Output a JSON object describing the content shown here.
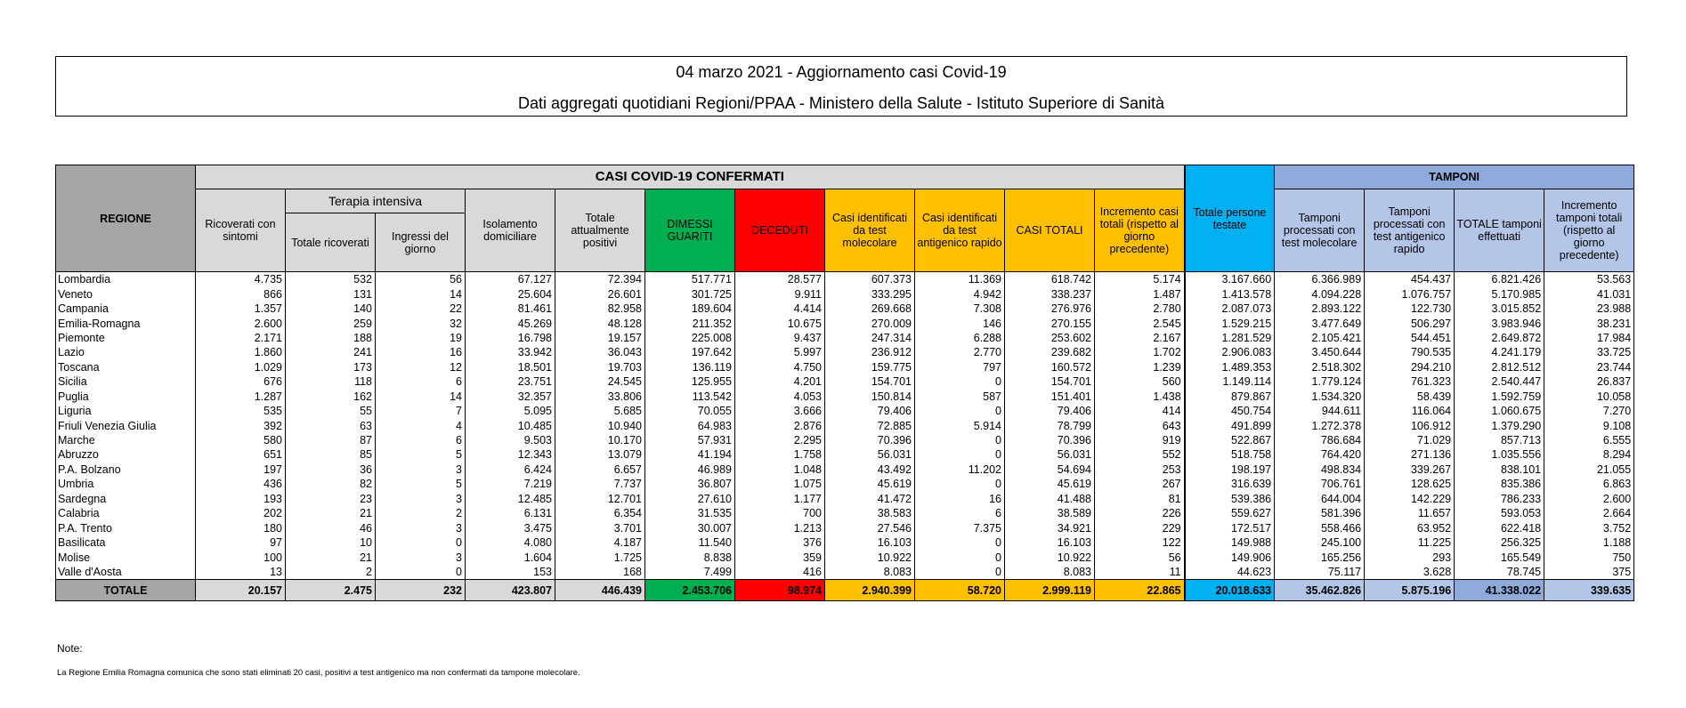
{
  "header": {
    "title": "04 marzo 2021 - Aggiornamento casi Covid-19",
    "subtitle": "Dati aggregati quotidiani Regioni/PPAA - Ministero della Salute - Istituto Superiore di Sanità"
  },
  "table": {
    "group_casi": "CASI COVID-19 CONFERMATI",
    "group_tamponi": "TAMPONI",
    "group_terapia": "Terapia intensiva",
    "columns": {
      "regione": "REGIONE",
      "ricoverati": "Ricoverati con sintomi",
      "ti_totale": "Totale ricoverati",
      "ti_ingressi": "Ingressi del giorno",
      "isolamento": "Isolamento domiciliare",
      "positivi": "Totale attualmente positivi",
      "dimessi": "DIMESSI GUARITI",
      "deceduti": "DECEDUTI",
      "casi_molecolare": "Casi identificati da test molecolare",
      "casi_antigenico": "Casi identificati da test antigenico rapido",
      "casi_totali": "CASI TOTALI",
      "incremento_casi": "Incremento casi totali (rispetto al giorno precedente)",
      "persone_testate": "Totale persone testate",
      "tamponi_molecolare": "Tamponi processati con test molecolare",
      "tamponi_antigenico": "Tamponi processati con test antigenico rapido",
      "tamponi_totale": "TOTALE tamponi effettuati",
      "incremento_tamponi": "Incremento tamponi totali (rispetto al giorno precedente)"
    },
    "rows": [
      [
        "Lombardia",
        "4.735",
        "532",
        "56",
        "67.127",
        "72.394",
        "517.771",
        "28.577",
        "607.373",
        "11.369",
        "618.742",
        "5.174",
        "3.167.660",
        "6.366.989",
        "454.437",
        "6.821.426",
        "53.563"
      ],
      [
        "Veneto",
        "866",
        "131",
        "14",
        "25.604",
        "26.601",
        "301.725",
        "9.911",
        "333.295",
        "4.942",
        "338.237",
        "1.487",
        "1.413.578",
        "4.094.228",
        "1.076.757",
        "5.170.985",
        "41.031"
      ],
      [
        "Campania",
        "1.357",
        "140",
        "22",
        "81.461",
        "82.958",
        "189.604",
        "4.414",
        "269.668",
        "7.308",
        "276.976",
        "2.780",
        "2.087.073",
        "2.893.122",
        "122.730",
        "3.015.852",
        "23.988"
      ],
      [
        "Emilia-Romagna",
        "2.600",
        "259",
        "32",
        "45.269",
        "48.128",
        "211.352",
        "10.675",
        "270.009",
        "146",
        "270.155",
        "2.545",
        "1.529.215",
        "3.477.649",
        "506.297",
        "3.983.946",
        "38.231"
      ],
      [
        "Piemonte",
        "2.171",
        "188",
        "19",
        "16.798",
        "19.157",
        "225.008",
        "9.437",
        "247.314",
        "6.288",
        "253.602",
        "2.167",
        "1.281.529",
        "2.105.421",
        "544.451",
        "2.649.872",
        "17.984"
      ],
      [
        "Lazio",
        "1.860",
        "241",
        "16",
        "33.942",
        "36.043",
        "197.642",
        "5.997",
        "236.912",
        "2.770",
        "239.682",
        "1.702",
        "2.906.083",
        "3.450.644",
        "790.535",
        "4.241.179",
        "33.725"
      ],
      [
        "Toscana",
        "1.029",
        "173",
        "12",
        "18.501",
        "19.703",
        "136.119",
        "4.750",
        "159.775",
        "797",
        "160.572",
        "1.239",
        "1.489.353",
        "2.518.302",
        "294.210",
        "2.812.512",
        "23.744"
      ],
      [
        "Sicilia",
        "676",
        "118",
        "6",
        "23.751",
        "24.545",
        "125.955",
        "4.201",
        "154.701",
        "0",
        "154.701",
        "560",
        "1.149.114",
        "1.779.124",
        "761.323",
        "2.540.447",
        "26.837"
      ],
      [
        "Puglia",
        "1.287",
        "162",
        "14",
        "32.357",
        "33.806",
        "113.542",
        "4.053",
        "150.814",
        "587",
        "151.401",
        "1.438",
        "879.867",
        "1.534.320",
        "58.439",
        "1.592.759",
        "10.058"
      ],
      [
        "Liguria",
        "535",
        "55",
        "7",
        "5.095",
        "5.685",
        "70.055",
        "3.666",
        "79.406",
        "0",
        "79.406",
        "414",
        "450.754",
        "944.611",
        "116.064",
        "1.060.675",
        "7.270"
      ],
      [
        "Friuli Venezia Giulia",
        "392",
        "63",
        "4",
        "10.485",
        "10.940",
        "64.983",
        "2.876",
        "72.885",
        "5.914",
        "78.799",
        "643",
        "491.899",
        "1.272.378",
        "106.912",
        "1.379.290",
        "9.108"
      ],
      [
        "Marche",
        "580",
        "87",
        "6",
        "9.503",
        "10.170",
        "57.931",
        "2.295",
        "70.396",
        "0",
        "70.396",
        "919",
        "522.867",
        "786.684",
        "71.029",
        "857.713",
        "6.555"
      ],
      [
        "Abruzzo",
        "651",
        "85",
        "5",
        "12.343",
        "13.079",
        "41.194",
        "1.758",
        "56.031",
        "0",
        "56.031",
        "552",
        "518.758",
        "764.420",
        "271.136",
        "1.035.556",
        "8.294"
      ],
      [
        "P.A. Bolzano",
        "197",
        "36",
        "3",
        "6.424",
        "6.657",
        "46.989",
        "1.048",
        "43.492",
        "11.202",
        "54.694",
        "253",
        "198.197",
        "498.834",
        "339.267",
        "838.101",
        "21.055"
      ],
      [
        "Umbria",
        "436",
        "82",
        "5",
        "7.219",
        "7.737",
        "36.807",
        "1.075",
        "45.619",
        "0",
        "45.619",
        "267",
        "316.639",
        "706.761",
        "128.625",
        "835.386",
        "6.863"
      ],
      [
        "Sardegna",
        "193",
        "23",
        "3",
        "12.485",
        "12.701",
        "27.610",
        "1.177",
        "41.472",
        "16",
        "41.488",
        "81",
        "539.386",
        "644.004",
        "142.229",
        "786.233",
        "2.600"
      ],
      [
        "Calabria",
        "202",
        "21",
        "2",
        "6.131",
        "6.354",
        "31.535",
        "700",
        "38.583",
        "6",
        "38.589",
        "226",
        "559.627",
        "581.396",
        "11.657",
        "593.053",
        "2.664"
      ],
      [
        "P.A. Trento",
        "180",
        "46",
        "3",
        "3.475",
        "3.701",
        "30.007",
        "1.213",
        "27.546",
        "7.375",
        "34.921",
        "229",
        "172.517",
        "558.466",
        "63.952",
        "622.418",
        "3.752"
      ],
      [
        "Basilicata",
        "97",
        "10",
        "0",
        "4.080",
        "4.187",
        "11.540",
        "376",
        "16.103",
        "0",
        "16.103",
        "122",
        "149.988",
        "245.100",
        "11.225",
        "256.325",
        "1.188"
      ],
      [
        "Molise",
        "100",
        "21",
        "3",
        "1.604",
        "1.725",
        "8.838",
        "359",
        "10.922",
        "0",
        "10.922",
        "56",
        "149.906",
        "165.256",
        "293",
        "165.549",
        "750"
      ],
      [
        "Valle d'Aosta",
        "13",
        "2",
        "0",
        "153",
        "168",
        "7.499",
        "416",
        "8.083",
        "0",
        "8.083",
        "11",
        "44.623",
        "75.117",
        "3.628",
        "78.745",
        "375"
      ]
    ],
    "totals": [
      "TOTALE",
      "20.157",
      "2.475",
      "232",
      "423.807",
      "446.439",
      "2.453.706",
      "98.974",
      "2.940.399",
      "58.720",
      "2.999.119",
      "22.865",
      "20.018.633",
      "35.462.826",
      "5.875.196",
      "41.338.022",
      "339.635"
    ]
  },
  "notes": {
    "label": "Note:",
    "text": "La Regione Emilia Romagna comunica che sono stati eliminati 20 casi, positivi a test antigenico ma non confermati da tampone molecolare."
  },
  "colors": {
    "dimessi": "#00b050",
    "deceduti": "#ff0000",
    "casi": "#ffc000",
    "persone_testate": "#00b0f0",
    "tamponi": "#b4c6e7"
  }
}
